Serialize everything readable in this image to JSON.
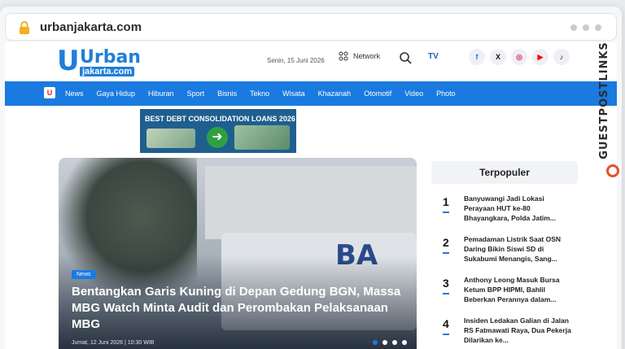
{
  "browser": {
    "url": "urbanjakarta.com"
  },
  "header": {
    "logo_main": "Urban",
    "logo_sub": "jakarta.com",
    "date": "Senin, 15 Juni 2026",
    "network_label": "Network",
    "tv_logo": "TV",
    "socials": [
      "f",
      "X",
      "ig",
      "yt",
      "tiktok"
    ]
  },
  "nav": {
    "brand_icon": "U",
    "items": [
      "News",
      "Gaya Hidup",
      "Hiburan",
      "Sport",
      "Bisnis",
      "Tekno",
      "Wisata",
      "Khazanah",
      "Otomotif",
      "Video",
      "Photo"
    ]
  },
  "ad": {
    "title": "BEST DEBT CONSOLIDATION LOANS 2026"
  },
  "hero": {
    "badge": "News",
    "title": "Bentangkan Garis Kuning di Depan Gedung BGN, Massa MBG Watch Minta Audit dan Perombakan Pelaksanaan MBG",
    "date": "Jumat, 12 Juni 2026 | 10:30 WIB",
    "sign_text": "BA"
  },
  "popular": {
    "heading": "Terpopuler",
    "items": [
      {
        "num": "1",
        "title": "Banyuwangi Jadi Lokasi Perayaan HUT ke-80 Bhayangkara, Polda Jatim..."
      },
      {
        "num": "2",
        "title": "Pemadaman Listrik Saat OSN Daring Bikin Siswi SD di Sukabumi Menangis, Sang..."
      },
      {
        "num": "3",
        "title": "Anthony Leong Masuk Bursa Ketum BPP HIPMI, Bahlil Beberkan Perannya dalam..."
      },
      {
        "num": "4",
        "title": "Insiden Ledakan Galian di Jalan RS Fatmawati Raya, Dua Pekerja Dilarikan ke..."
      }
    ]
  },
  "side_brand": {
    "text": "GUESTPOSTLINKS"
  },
  "colors": {
    "accent": "#1a7ae0",
    "brand": "#1f7fd8",
    "side_brand_icon": "#e5502a"
  }
}
